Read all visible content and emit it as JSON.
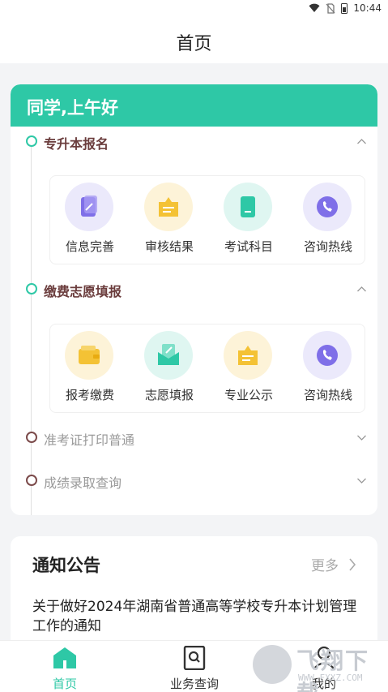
{
  "status_bar": {
    "time": "10:44",
    "icons": [
      "wifi-icon",
      "no-sim-icon",
      "battery-icon"
    ]
  },
  "nav": {
    "title": "首页"
  },
  "greeting": "同学,上午好",
  "sections": [
    {
      "label": "专升本报名",
      "expanded": true,
      "items": [
        {
          "label": "信息完善",
          "icon": "edit-document-icon",
          "bg": "#ebe9fb",
          "color": "#7f6fe8"
        },
        {
          "label": "审核结果",
          "icon": "review-folder-icon",
          "bg": "#fdf3d8",
          "color": "#f4c235"
        },
        {
          "label": "考试科目",
          "icon": "book-icon",
          "bg": "#dff6f1",
          "color": "#2ec8a6"
        },
        {
          "label": "咨询热线",
          "icon": "phone-icon",
          "bg": "#ebe9fb",
          "color": "#7f6fe8"
        }
      ]
    },
    {
      "label": "缴费志愿填报",
      "expanded": true,
      "items": [
        {
          "label": "报考缴费",
          "icon": "wallet-icon",
          "bg": "#fdf3d8",
          "color": "#f4c235"
        },
        {
          "label": "志愿填报",
          "icon": "envelope-pen-icon",
          "bg": "#dff6f1",
          "color": "#2ec8a6"
        },
        {
          "label": "专业公示",
          "icon": "list-folder-icon",
          "bg": "#fdf3d8",
          "color": "#f4c235"
        },
        {
          "label": "咨询热线",
          "icon": "phone-icon",
          "bg": "#ebe9fb",
          "color": "#7f6fe8"
        }
      ]
    },
    {
      "label": "准考证打印普通",
      "expanded": false
    },
    {
      "label": "成绩录取查询",
      "expanded": false
    }
  ],
  "notice": {
    "title": "通知公告",
    "more": "更多",
    "items": [
      "关于做好2024年湖南省普通高等学校专升本计划管理工作的通知"
    ]
  },
  "tabs": [
    {
      "label": "首页",
      "icon": "home-icon",
      "active": true
    },
    {
      "label": "业务查询",
      "icon": "search-doc-icon",
      "active": false
    },
    {
      "label": "我的",
      "icon": "profile-icon",
      "active": false
    }
  ],
  "watermark": {
    "text": "飞翔下载",
    "url": "WWW.FXXZ.COM"
  },
  "colors": {
    "accent": "#2ec8a6",
    "section_title": "#6b3d3d",
    "muted": "#9a9a9a"
  }
}
